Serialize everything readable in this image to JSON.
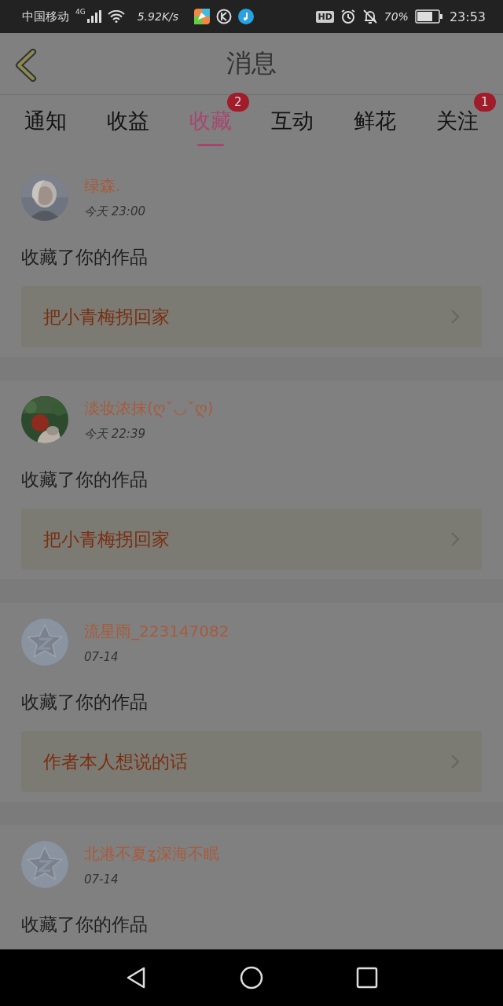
{
  "status_bar": {
    "carrier": "中国移动",
    "network": "4G",
    "speed": "5.92K/s",
    "hd": "HD",
    "battery": "70%",
    "time": "23:53"
  },
  "header": {
    "title": "消息"
  },
  "tabs": [
    {
      "label": "通知",
      "selected": false
    },
    {
      "label": "收益",
      "selected": false
    },
    {
      "label": "收藏",
      "selected": true,
      "badge": "2"
    },
    {
      "label": "互动",
      "selected": false
    },
    {
      "label": "鲜花",
      "selected": false
    },
    {
      "label": "关注",
      "selected": false,
      "badge": "1"
    }
  ],
  "messages": [
    {
      "name": "绿森.",
      "time": "今天 23:00",
      "action": "收藏了你的作品",
      "work": "把小青梅拐回家"
    },
    {
      "name": "淡妆浓抹(ღˇ◡ˇღ)",
      "time": "今天 22:39",
      "action": "收藏了你的作品",
      "work": "把小青梅拐回家"
    },
    {
      "avatar": {
        "kind": "icon"
      },
      "name": "流星雨_223147082",
      "time": "07-14",
      "action": "收藏了你的作品",
      "work": "作者本人想说的话"
    },
    {
      "avatar": {
        "kind": "icon"
      },
      "name": "北港不夏ʓ深海不眠",
      "time": "07-14",
      "action": "收藏了你的作品"
    }
  ]
}
